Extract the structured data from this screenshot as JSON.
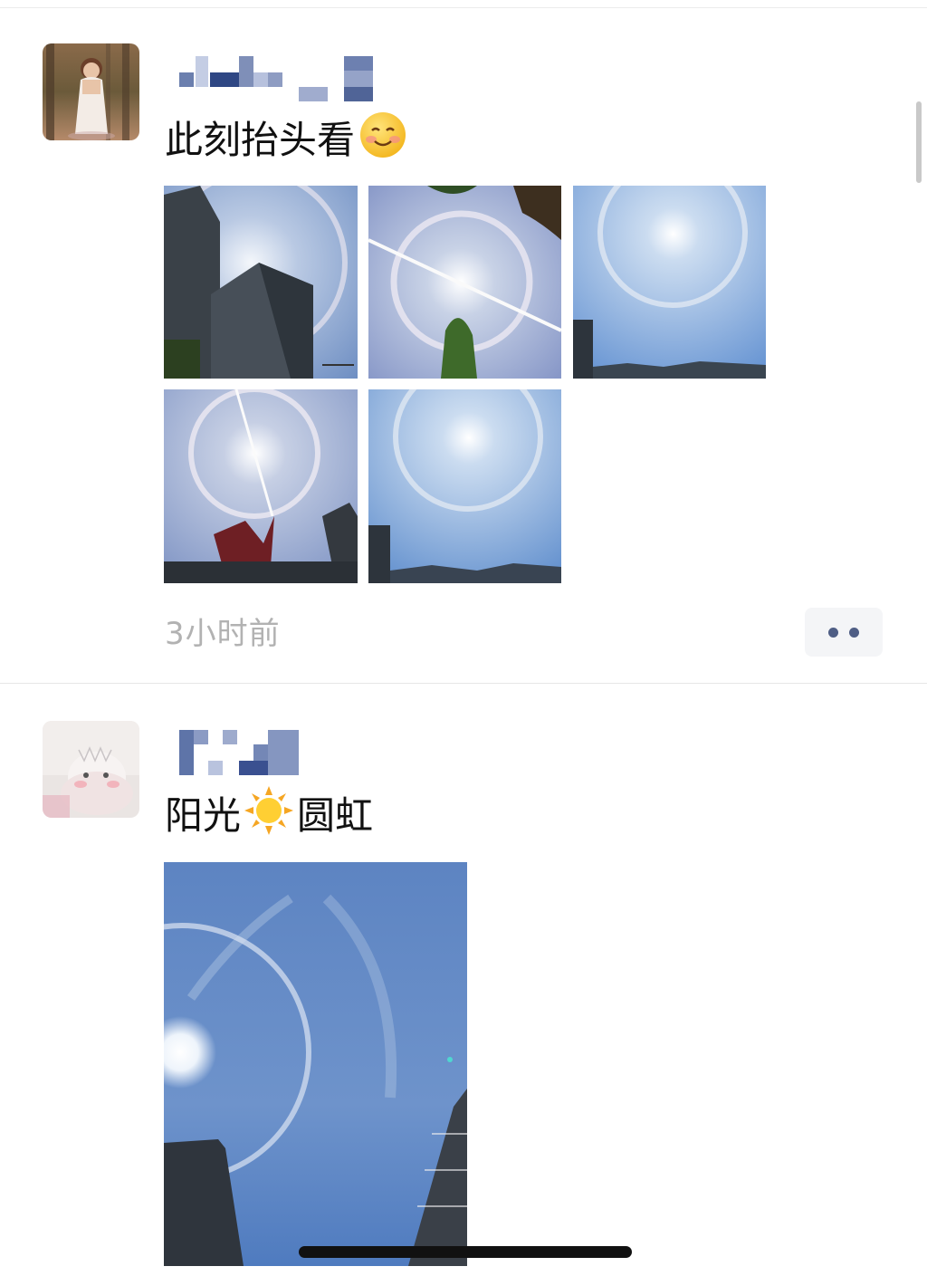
{
  "feed": {
    "posts": [
      {
        "text": "此刻抬头看",
        "emoji_icon": "smiling-face-icon",
        "timestamp": "3小时前",
        "photos": 5
      },
      {
        "text_before": "阳光",
        "emoji_icon": "sun-icon",
        "text_after": "圆虹",
        "photos": 1
      }
    ]
  },
  "colors": {
    "accent": "#4f5e85",
    "timestamp": "#b2b2b2",
    "sky": "#6e93c8"
  }
}
